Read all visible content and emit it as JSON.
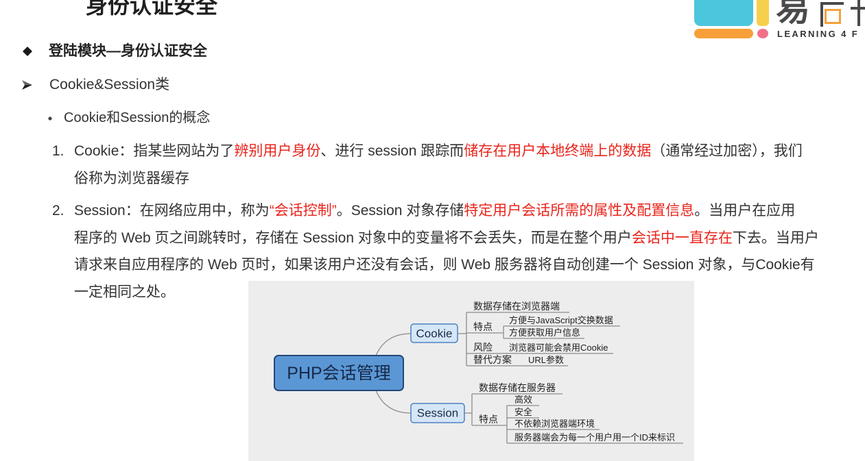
{
  "slide": {
    "title": "身份认证安全",
    "heading": "登陆模块—身份认证安全",
    "subheading": "Cookie&Session类",
    "bullet": "Cookie和Session的概念",
    "items": [
      {
        "number": "1.",
        "lines": [
          [
            {
              "text": "Cookie：指某些网站为了",
              "highlight": false
            },
            {
              "text": "辨别用户身份",
              "highlight": true
            },
            {
              "text": "、进行 session 跟踪而",
              "highlight": false
            },
            {
              "text": "储存在用户本地终端上的数据",
              "highlight": true
            },
            {
              "text": "（通常经过加密），我们",
              "highlight": false
            }
          ],
          [
            {
              "text": "俗称为浏览器缓存",
              "highlight": false
            }
          ]
        ]
      },
      {
        "number": "2.",
        "lines": [
          [
            {
              "text": "Session：在网络应用中，称为",
              "highlight": false
            },
            {
              "text": "“会话控制”",
              "highlight": true
            },
            {
              "text": "。Session 对象存储",
              "highlight": false
            },
            {
              "text": "特定用户会话所需的属性及配置信息",
              "highlight": true
            },
            {
              "text": "。当用户在应用",
              "highlight": false
            }
          ],
          [
            {
              "text": "程序的 Web 页之间跳转时，存储在 Session 对象中的变量将不会丢失，而是在整个用户",
              "highlight": false
            },
            {
              "text": "会话中一直存在",
              "highlight": true
            },
            {
              "text": "下去。当用户",
              "highlight": false
            }
          ],
          [
            {
              "text": "请求来自应用程序的 Web 页时，如果该用户还没有会话，则 Web 服务器将自动创建一个 Session 对象，与Cookie有",
              "highlight": false
            }
          ],
          [
            {
              "text": "一定相同之处。",
              "highlight": false
            }
          ]
        ]
      }
    ]
  },
  "icons": {
    "heading_bullet": "diamond-bullet-icon",
    "subheading_bullet": "arrow-bullet-icon",
    "concept_bullet": "dot-bullet-icon"
  },
  "logo": {
    "glyph": "易",
    "tagline": "LEARNING 4 F",
    "colors": {
      "cyan": "#4cc6dc",
      "yellow": "#f6d04d",
      "orange": "#f7a03a",
      "pink": "#f0708a"
    }
  },
  "diagram": {
    "root": "PHP会话管理",
    "branches": [
      {
        "label": "Cookie",
        "children": [
          {
            "label": "数据存储在浏览器端"
          },
          {
            "label": "特点",
            "children": [
              "方便与JavaScript交换数据",
              "方便获取用户信息"
            ]
          },
          {
            "label": "风险",
            "children": [
              "浏览器可能会禁用Cookie"
            ]
          },
          {
            "label": "替代方案",
            "children": [
              "URL参数"
            ]
          }
        ]
      },
      {
        "label": "Session",
        "children": [
          {
            "label": "数据存储在服务器"
          },
          {
            "label": "特点",
            "children": [
              "高效",
              "安全",
              "不依赖浏览器端环境",
              "服务器端会为每一个用户用一个ID来标识"
            ]
          }
        ]
      }
    ]
  },
  "colors": {
    "text": "#333333",
    "highlight": "#e8251c",
    "root_fill": "#5b97d4",
    "node_fill": "#d5e6f6",
    "diagram_bg": "#ededed"
  }
}
